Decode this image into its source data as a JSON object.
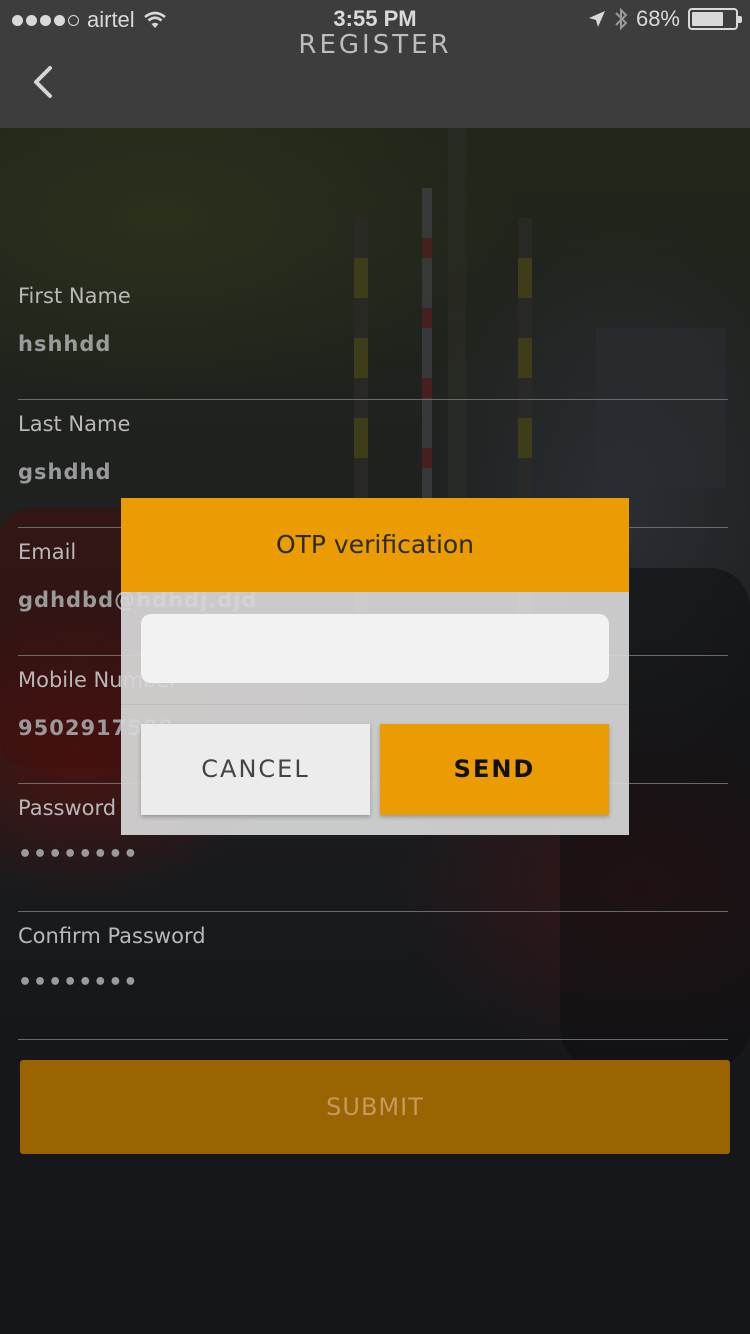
{
  "status_bar": {
    "carrier": "airtel",
    "time": "3:55 PM",
    "battery": "68%",
    "battery_level": 0.68,
    "signal_bars": 4,
    "icons": [
      "wifi-icon",
      "location-arrow-icon",
      "bluetooth-icon",
      "battery-icon"
    ]
  },
  "nav": {
    "title": "REGISTER",
    "back_icon": "chevron-left-icon"
  },
  "form": {
    "fields": [
      {
        "label": "First Name",
        "value": "hshhdd"
      },
      {
        "label": "Last Name",
        "value": "gshdhd"
      },
      {
        "label": "Email",
        "value": "gdhdbd@hdhdj.djd"
      },
      {
        "label": "Mobile Number",
        "value": "9502917588"
      },
      {
        "label": "Password",
        "value": "••••••••"
      },
      {
        "label": "Confirm Password",
        "value": "••••••••"
      }
    ],
    "submit_label": "SUBMIT"
  },
  "otp_modal": {
    "title": "OTP verification",
    "input_value": "",
    "cancel_label": "CANCEL",
    "send_label": "SEND"
  },
  "colors": {
    "accent": "#eb9c02",
    "submit_dimmed": "#9a6402",
    "topbar": "#3d3d3d"
  }
}
